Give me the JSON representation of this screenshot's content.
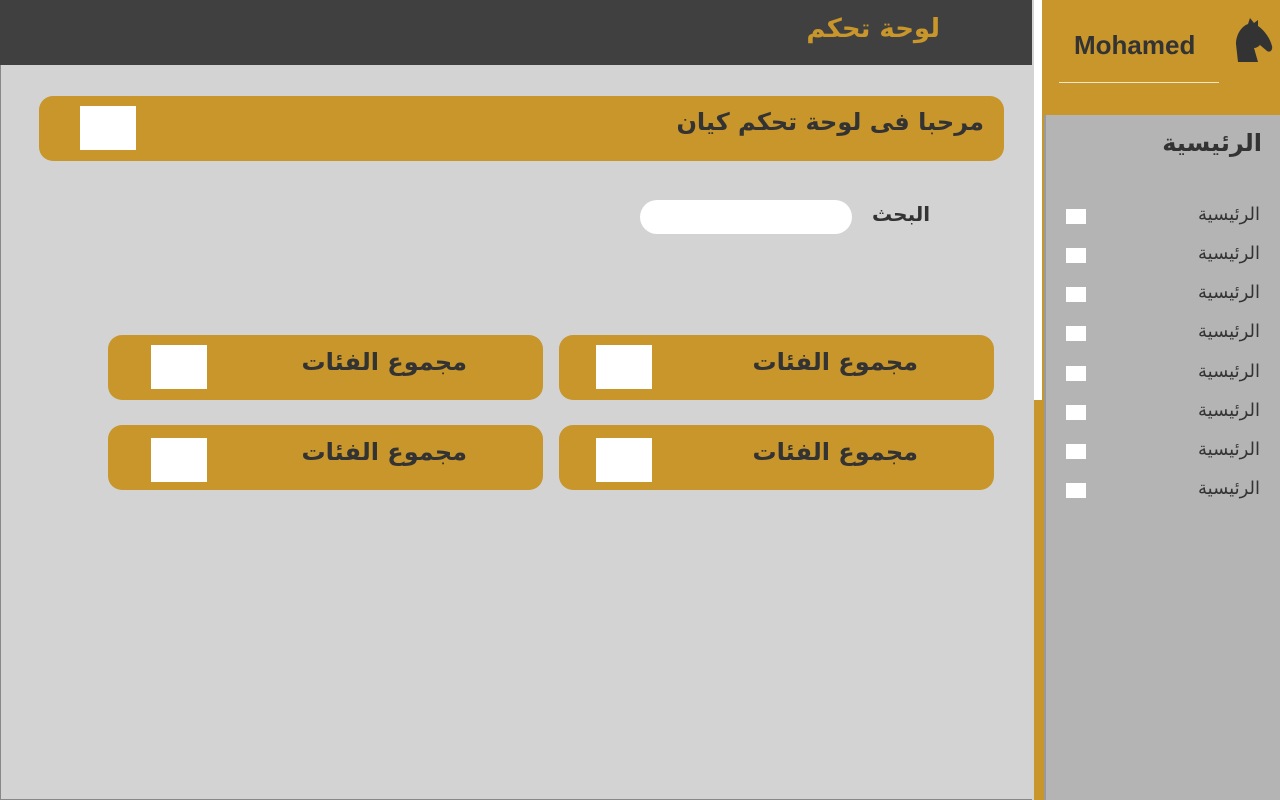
{
  "header": {
    "title": "لوحة تحكم"
  },
  "user": {
    "name": "Mohamed",
    "avatar_icon": "horse-head-icon"
  },
  "sidebar": {
    "title": "الرئيسية",
    "items": [
      {
        "label": "الرئيسية"
      },
      {
        "label": "الرئيسية"
      },
      {
        "label": "الرئيسية"
      },
      {
        "label": "الرئيسية"
      },
      {
        "label": "الرئيسية"
      },
      {
        "label": "الرئيسية"
      },
      {
        "label": "الرئيسية"
      },
      {
        "label": "الرئيسية"
      }
    ]
  },
  "welcome": {
    "text": "مرحبا فى لوحة تحكم كيان"
  },
  "search": {
    "label": "البحث",
    "value": "",
    "placeholder": ""
  },
  "cards": [
    {
      "label": "مجموع الفئات"
    },
    {
      "label": "مجموع الفئات"
    },
    {
      "label": "مجموع الفئات"
    },
    {
      "label": "مجموع الفئات"
    }
  ],
  "colors": {
    "accent": "#c8962b",
    "header_bg": "#404040",
    "main_bg": "#d3d3d3",
    "sidebar_bg": "#b4b4b4"
  }
}
